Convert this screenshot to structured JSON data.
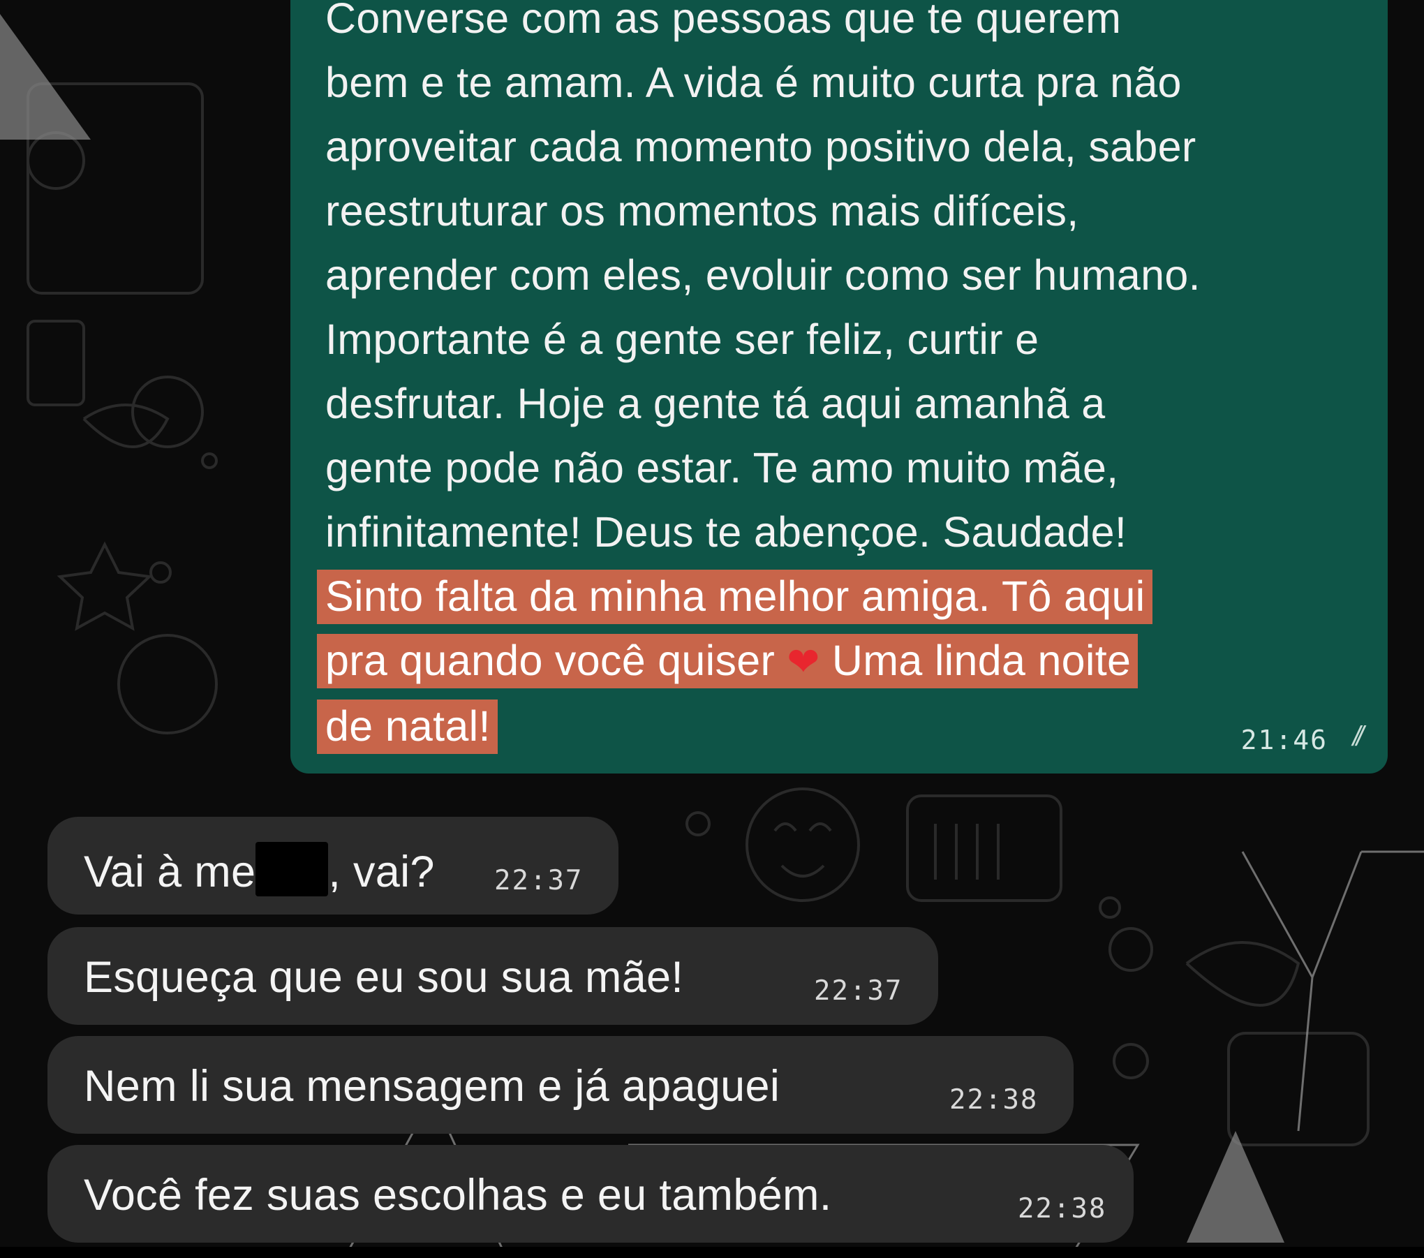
{
  "chat": {
    "sent_message": {
      "lines": [
        "Converse com as pessoas que te querem",
        "bem e te amam. A vida é muito curta pra não",
        "aproveitar cada momento positivo dela, saber",
        "reestruturar os momentos mais difíceis,",
        "aprender com eles, evoluir como ser humano.",
        "Importante é a gente ser feliz, curtir e",
        "desfrutar. Hoje a gente tá aqui amanhã a",
        "gente pode não estar. Te amo muito mãe,",
        "infinitamente! Deus te abençoe. Saudade!"
      ],
      "highlighted_line_1": "Sinto falta da minha melhor amiga. Tô aqui",
      "highlighted_line_2_before_emoji": "pra quando você quiser",
      "emoji": "❤",
      "highlighted_line_2_after_emoji": "Uma linda noite",
      "highlighted_line_3": "de natal!",
      "time": "21:46",
      "read_ticks": "//"
    },
    "received_messages": [
      {
        "text_before_redaction": "Vai à me",
        "text_after_redaction": ", vai?",
        "time": "22:37"
      },
      {
        "text": "Esqueça que eu sou sua mãe!",
        "time": "22:37"
      },
      {
        "text": "Nem li sua mensagem e já apaguei",
        "time": "22:38"
      },
      {
        "text": "Você fez suas escolhas e eu também.",
        "time": "22:38"
      }
    ]
  },
  "colors": {
    "background": "#0b0b0b",
    "sent_bubble": "#0e5447",
    "received_bubble": "#2b2b2b",
    "highlight": "#c8654a",
    "heart": "#e8262e"
  }
}
